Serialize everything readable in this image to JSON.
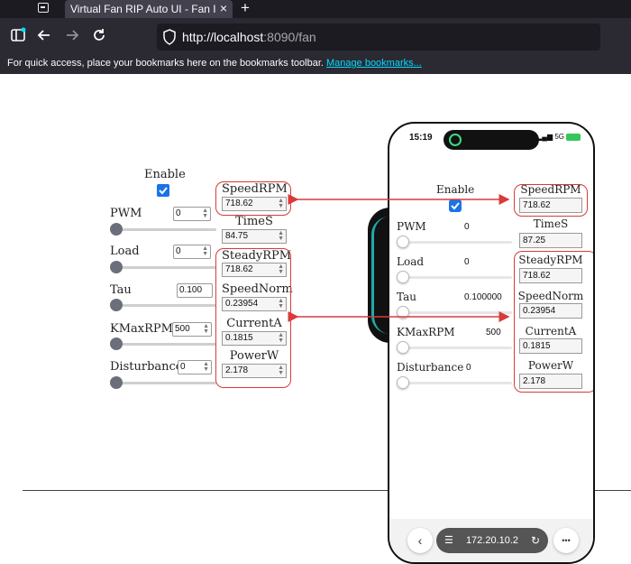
{
  "browser": {
    "tab_title": "Virtual Fan RIP Auto UI - Fan Ima",
    "tab_close": "×",
    "new_tab": "+",
    "url_host": "http://localhost",
    "url_rest": ":8090/fan",
    "bookmarks_message": "For quick access, place your bookmarks here on the bookmarks toolbar.",
    "manage_bookmarks": "Manage bookmarks..."
  },
  "desktop": {
    "enable_label": "Enable",
    "enable_checked": true,
    "params": [
      {
        "label": "PWM",
        "value": "0"
      },
      {
        "label": "Load",
        "value": "0"
      },
      {
        "label": "Tau",
        "value": "0.100"
      },
      {
        "label": "KMaxRPM",
        "value": "500"
      },
      {
        "label": "Disturbance",
        "value": "0"
      }
    ],
    "outputs": [
      {
        "label": "SpeedRPM",
        "value": "718.62"
      },
      {
        "label": "TimeS",
        "value": "84.75"
      },
      {
        "label": "SteadyRPM",
        "value": "718.62"
      },
      {
        "label": "SpeedNorm",
        "value": "0.23954"
      },
      {
        "label": "CurrentA",
        "value": "0.1815"
      },
      {
        "label": "PowerW",
        "value": "2.178"
      }
    ]
  },
  "phone": {
    "time": "15:19",
    "network": "5G",
    "enable_label": "Enable",
    "params": [
      {
        "label": "PWM",
        "value": "0"
      },
      {
        "label": "Load",
        "value": "0"
      },
      {
        "label": "Tau",
        "value": "0.100000"
      },
      {
        "label": "KMaxRPM",
        "value": "500"
      },
      {
        "label": "Disturbance",
        "value": "0"
      }
    ],
    "outputs": [
      {
        "label": "SpeedRPM",
        "value": "718.62"
      },
      {
        "label": "TimeS",
        "value": "87.25"
      },
      {
        "label": "SteadyRPM",
        "value": "718.62"
      },
      {
        "label": "SpeedNorm",
        "value": "0.23954"
      },
      {
        "label": "CurrentA",
        "value": "0.1815"
      },
      {
        "label": "PowerW",
        "value": "2.178"
      }
    ],
    "address": "172.20.10.2",
    "back_icon": "‹",
    "more_icon": "•••"
  },
  "colors": {
    "annotation_red": "#d93a3a",
    "checkbox_blue": "#1a73e8",
    "browser_dark": "#2b2a33",
    "link_cyan": "#00ddff"
  }
}
